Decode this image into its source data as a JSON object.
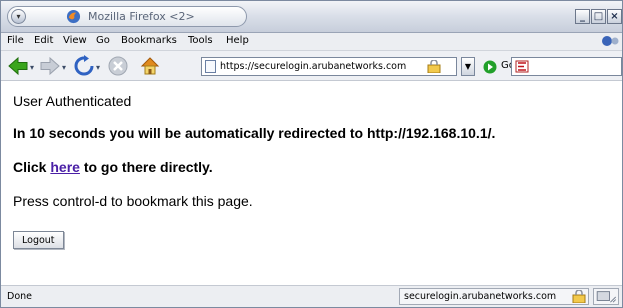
{
  "window": {
    "title": "Mozilla Firefox <2>",
    "controls": {
      "minimize": "_",
      "maximize": "□",
      "close": "×"
    }
  },
  "menubar": {
    "items": [
      {
        "label": "File"
      },
      {
        "label": "Edit"
      },
      {
        "label": "View"
      },
      {
        "label": "Go"
      },
      {
        "label": "Bookmarks"
      },
      {
        "label": "Tools"
      },
      {
        "label": "Help"
      }
    ]
  },
  "toolbar": {
    "url": "https://securelogin.arubanetworks.com",
    "go_label": "Go",
    "search_value": "",
    "icons": [
      "back-arrow-icon",
      "forward-arrow-icon",
      "reload-icon",
      "stop-icon",
      "home-icon",
      "page-icon",
      "lock-icon",
      "go-icon",
      "search-engine-icon"
    ]
  },
  "page": {
    "line1": "User Authenticated",
    "line2": "In 10 seconds you will be automatically redirected to http://192.168.10.1/.",
    "line3_prefix": "Click ",
    "line3_link": "here",
    "line3_suffix": " to go there directly.",
    "line4": "Press control-d to bookmark this page.",
    "logout_label": "Logout"
  },
  "statusbar": {
    "status": "Done",
    "domain": "securelogin.arubanetworks.com"
  },
  "colors": {
    "link": "#4a1fa6",
    "back_arrow": "#3aa51c",
    "go_green": "#22a02a"
  }
}
